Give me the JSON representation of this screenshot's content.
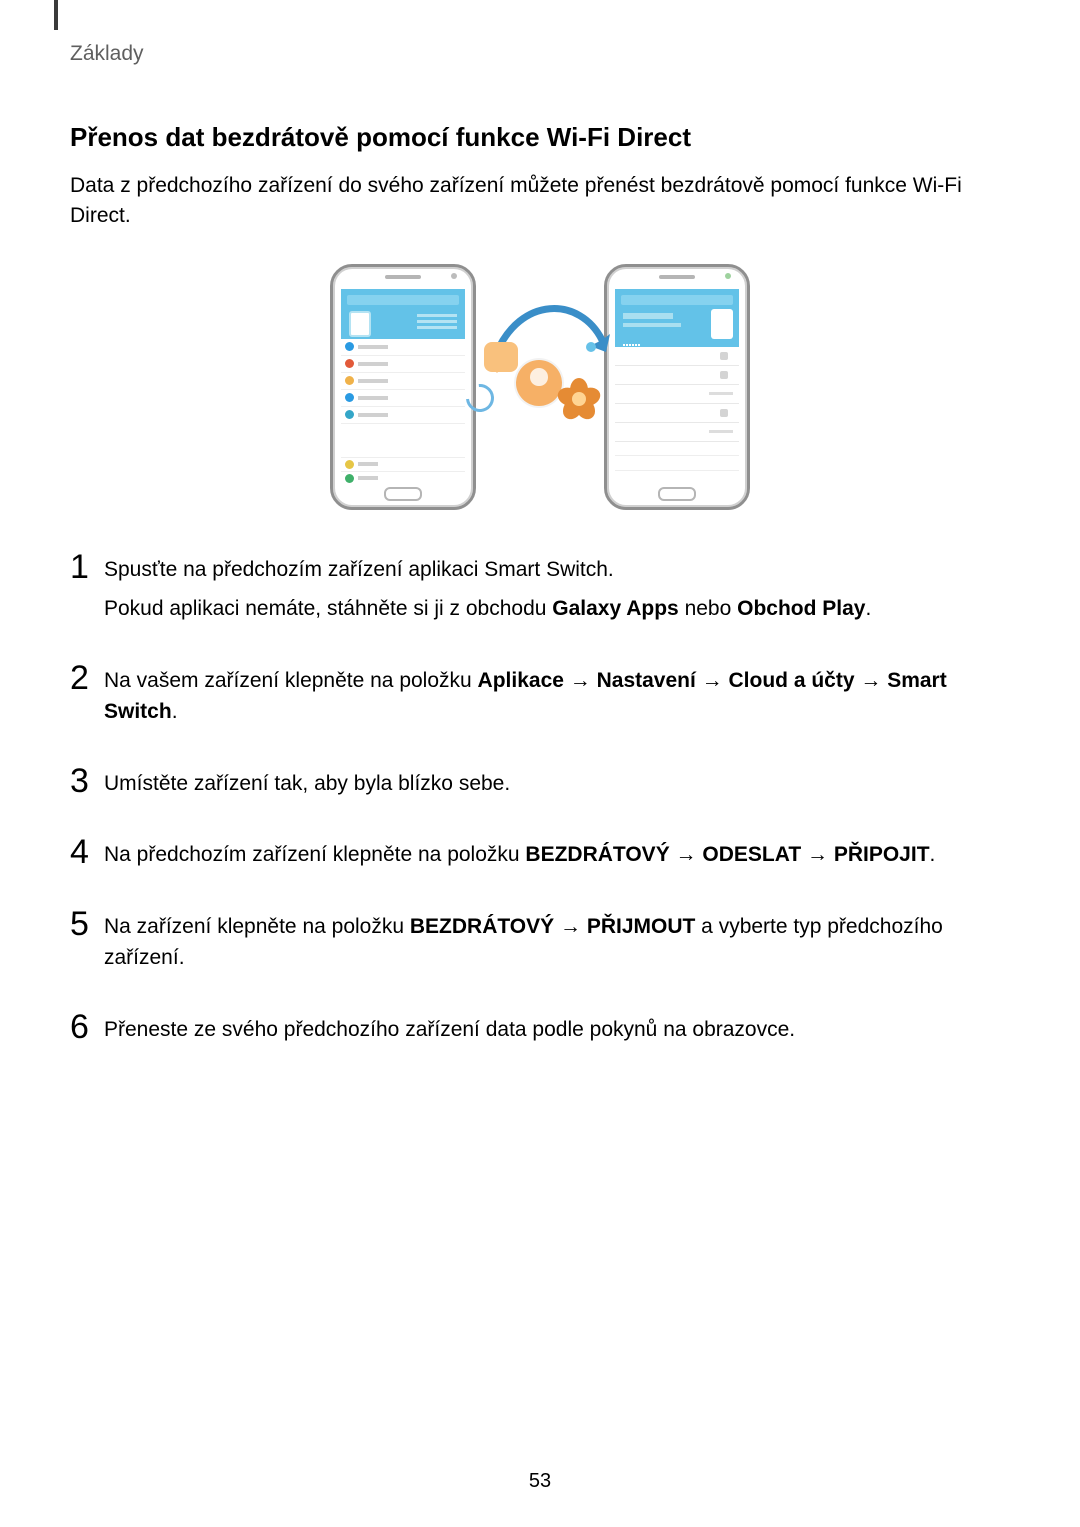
{
  "header": {
    "section_label": "Základy"
  },
  "title": "Přenos dat bezdrátově pomocí funkce Wi-Fi Direct",
  "intro": "Data z předchozího zařízení do svého zařízení můžete přenést bezdrátově pomocí funkce Wi-Fi Direct.",
  "steps": {
    "1": {
      "num": "1",
      "line1": "Spusťte na předchozím zařízení aplikaci Smart Switch.",
      "line2_pre": "Pokud aplikaci nemáte, stáhněte si ji z obchodu ",
      "line2_b1": "Galaxy Apps",
      "line2_mid": " nebo ",
      "line2_b2": "Obchod Play",
      "line2_end": "."
    },
    "2": {
      "num": "2",
      "pre": "Na vašem zařízení klepněte na položku ",
      "b1": "Aplikace",
      "a1": " → ",
      "b2": "Nastavení",
      "a2": " → ",
      "b3": "Cloud a účty",
      "a3": " → ",
      "b4": "Smart Switch",
      "end": "."
    },
    "3": {
      "num": "3",
      "text": "Umístěte zařízení tak, aby byla blízko sebe."
    },
    "4": {
      "num": "4",
      "pre": "Na předchozím zařízení klepněte na položku ",
      "b1": "BEZDRÁTOVÝ",
      "a1": " → ",
      "b2": "ODESLAT",
      "a2": " → ",
      "b3": "PŘIPOJIT",
      "end": "."
    },
    "5": {
      "num": "5",
      "pre": "Na zařízení klepněte na položku ",
      "b1": "BEZDRÁTOVÝ",
      "a1": " → ",
      "b2": "PŘIJMOUT",
      "end": " a vyberte typ předchozího zařízení."
    },
    "6": {
      "num": "6",
      "text": "Přeneste ze svého předchozího zařízení data podle pokynů na obrazovce."
    }
  },
  "page_number": "53"
}
